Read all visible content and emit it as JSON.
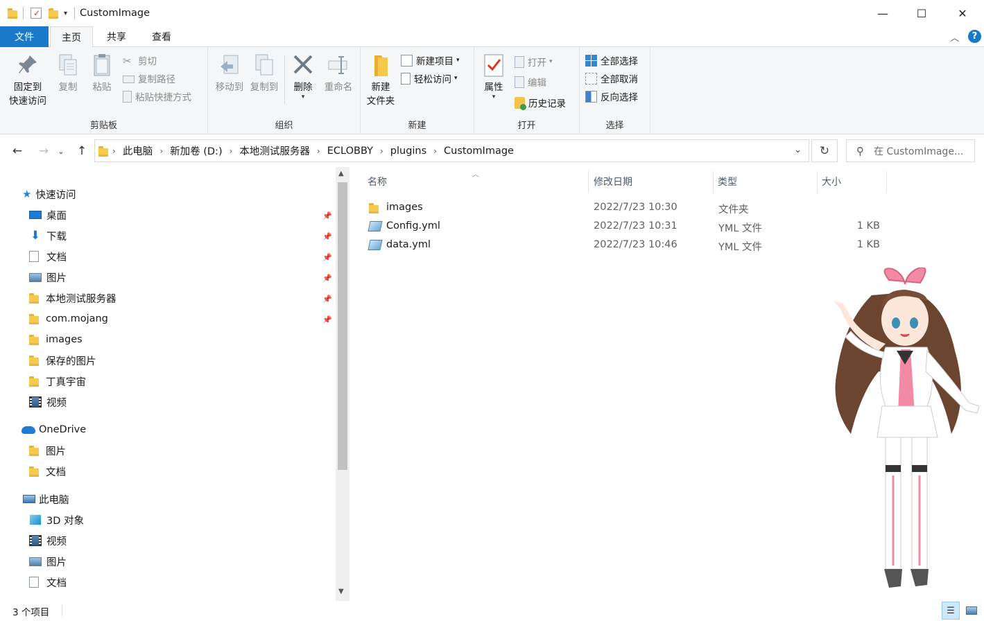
{
  "window": {
    "title": "CustomImage",
    "minimize_glyph": "—",
    "maximize_glyph": "☐",
    "close_glyph": "✕"
  },
  "tabs": [
    "文件",
    "主页",
    "共享",
    "查看"
  ],
  "ribbon": {
    "clipboard": {
      "label": "剪贴板",
      "pin_line1": "固定到",
      "pin_line2": "快速访问",
      "copy": "复制",
      "paste": "粘贴",
      "cut": "剪切",
      "copy_path": "复制路径",
      "paste_shortcut": "粘贴快捷方式"
    },
    "organize": {
      "label": "组织",
      "move_to": "移动到",
      "copy_to": "复制到",
      "delete": "删除",
      "rename": "重命名"
    },
    "new": {
      "label": "新建",
      "new_folder_line1": "新建",
      "new_folder_line2": "文件夹",
      "new_item": "新建项目",
      "easy_access": "轻松访问"
    },
    "open": {
      "label": "打开",
      "properties": "属性",
      "open": "打开",
      "edit": "编辑",
      "history": "历史记录"
    },
    "select": {
      "label": "选择",
      "select_all": "全部选择",
      "select_none": "全部取消",
      "invert": "反向选择"
    }
  },
  "address": {
    "crumbs": [
      "此电脑",
      "新加卷 (D:)",
      "本地测试服务器",
      "ECLOBBY",
      "plugins",
      "CustomImage"
    ],
    "search_placeholder": "在 CustomImage..."
  },
  "nav": {
    "quick_access": "快速访问",
    "quick_items": [
      "桌面",
      "下载",
      "文档",
      "图片",
      "本地测试服务器",
      "com.mojang",
      "images",
      "保存的图片",
      "丁真宇宙",
      "视频"
    ],
    "onedrive": "OneDrive",
    "onedrive_items": [
      "图片",
      "文档"
    ],
    "this_pc": "此电脑",
    "pc_items": [
      "3D 对象",
      "视频",
      "图片",
      "文档"
    ]
  },
  "columns": [
    "名称",
    "修改日期",
    "类型",
    "大小"
  ],
  "files": [
    {
      "name": "images",
      "date": "2022/7/23 10:30",
      "type": "文件夹",
      "size": ""
    },
    {
      "name": "Config.yml",
      "date": "2022/7/23 10:31",
      "type": "YML 文件",
      "size": "1 KB"
    },
    {
      "name": "data.yml",
      "date": "2022/7/23 10:46",
      "type": "YML 文件",
      "size": "1 KB"
    }
  ],
  "status": {
    "count": "3 个项目"
  },
  "colors": {
    "accent": "#1979ca",
    "ribbon_bg": "#f5f6f7",
    "folder": "#f6c94f"
  }
}
